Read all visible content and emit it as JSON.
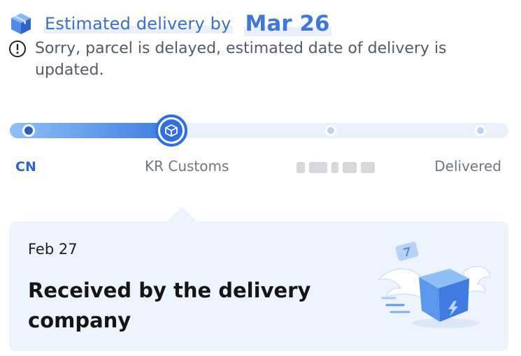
{
  "delivery": {
    "eta_label": "Estimated delivery by",
    "eta_date": "Mar 26",
    "delay_message": "Sorry, parcel is delayed, estimated date of delivery is updated."
  },
  "progress": {
    "current_stage_index": 1,
    "stages": [
      {
        "label": "CN"
      },
      {
        "label": "KR Customs"
      },
      {
        "label": ""
      },
      {
        "label": "Delivered"
      }
    ]
  },
  "latest_event": {
    "date": "Feb 27",
    "status": "Received by the delivery company"
  },
  "colors": {
    "accent": "#3f78d8",
    "track_fill_end": "#3a7ae0",
    "track_bg": "#eaf0fa",
    "card_bg": "#eef4fd"
  },
  "icons": {
    "eta": "package-box-icon",
    "alert": "alert-circle-icon",
    "current_stage": "box-icon",
    "illustration": "flying-package-illustration"
  }
}
